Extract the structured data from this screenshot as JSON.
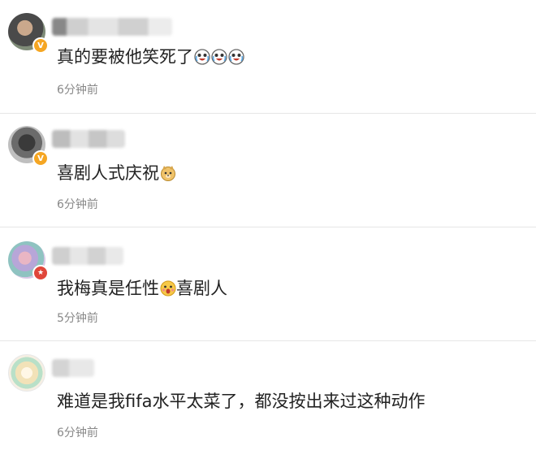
{
  "comments": [
    {
      "text": "真的要被他笑死了",
      "time": "6分钟前",
      "badge": "V",
      "badge_color": "#f5a623",
      "emoji": [
        "laughing-cry-face-icon",
        "laughing-cry-face-icon",
        "laughing-cry-face-icon"
      ]
    },
    {
      "text": "喜剧人式庆祝",
      "time": "6分钟前",
      "badge": "V",
      "badge_color": "#f5a623",
      "emoji": [
        "doge-icon"
      ]
    },
    {
      "text_before": "我梅真是任性",
      "text_after": "喜剧人",
      "time": "5分钟前",
      "badge": "★",
      "badge_color": "#e0463a",
      "emoji": [
        "shocked-face-icon"
      ]
    },
    {
      "text": "难道是我fifa水平太菜了，都没按出来过这种动作",
      "time": "6分钟前",
      "emoji": []
    }
  ]
}
